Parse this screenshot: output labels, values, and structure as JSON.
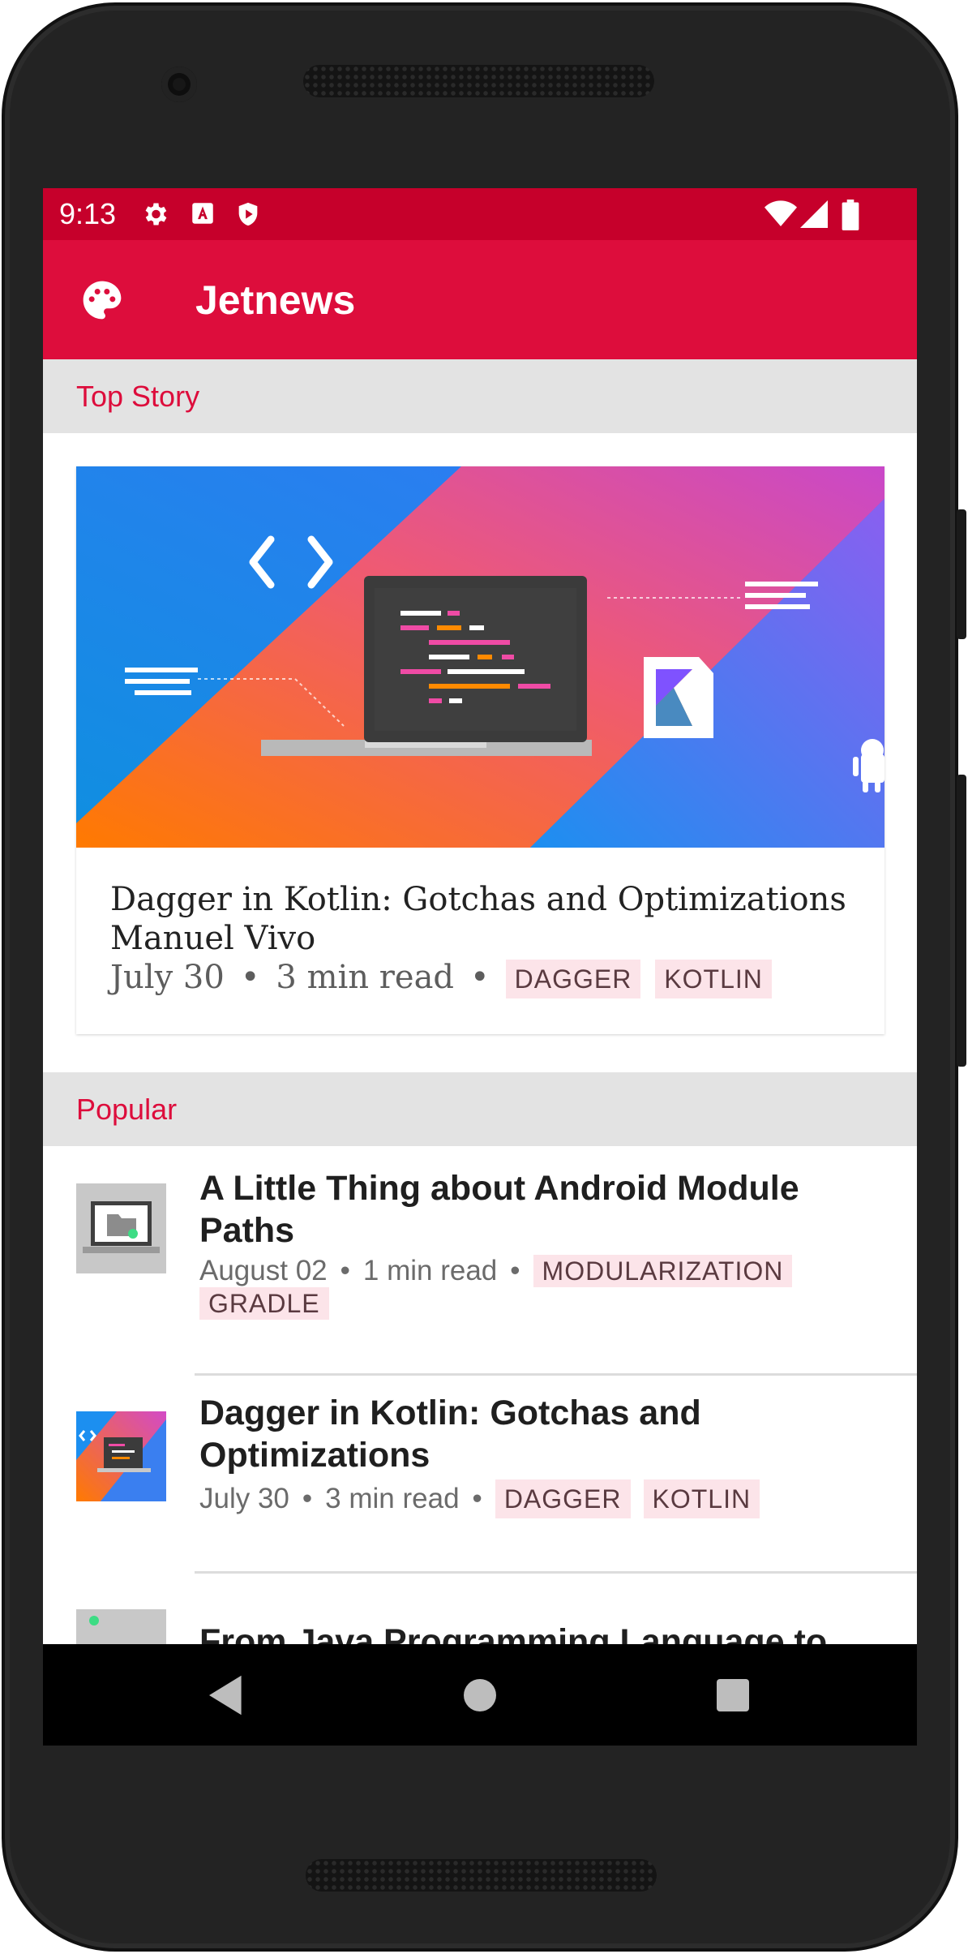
{
  "status_bar": {
    "time": "9:13",
    "icons": [
      "gear-icon",
      "font-icon",
      "shield-play-icon",
      "wifi-icon",
      "signal-icon",
      "battery-icon"
    ]
  },
  "app_bar": {
    "title": "Jetnews",
    "icon": "palette-icon",
    "color": "#dd0d3c"
  },
  "sections": {
    "top_story": "Top Story",
    "popular": "Popular"
  },
  "top_story": {
    "title": "Dagger in Kotlin: Gotchas and Optimizations",
    "author": "Manuel Vivo",
    "date": "July 30",
    "read_time": "3 min read",
    "tags": [
      "DAGGER",
      "KOTLIN"
    ]
  },
  "popular": [
    {
      "title": "A Little Thing about Android Module Paths",
      "date": "August 02",
      "read_time": "1 min read",
      "tags": [
        "MODULARIZATION",
        "GRADLE"
      ]
    },
    {
      "title": "Dagger in Kotlin: Gotchas and Optimizations",
      "date": "July 30",
      "read_time": "3 min read",
      "tags": [
        "DAGGER",
        "KOTLIN"
      ]
    },
    {
      "title": "From Java Programming Language to Kotlin"
    }
  ],
  "nav_bar": {
    "buttons": [
      "back-icon",
      "home-icon",
      "recents-icon"
    ]
  },
  "colors": {
    "status_bar": "#c6002b",
    "accent": "#dd0d3c",
    "tag_bg": "#fce4e9",
    "section_bg": "#e3e3e3"
  }
}
